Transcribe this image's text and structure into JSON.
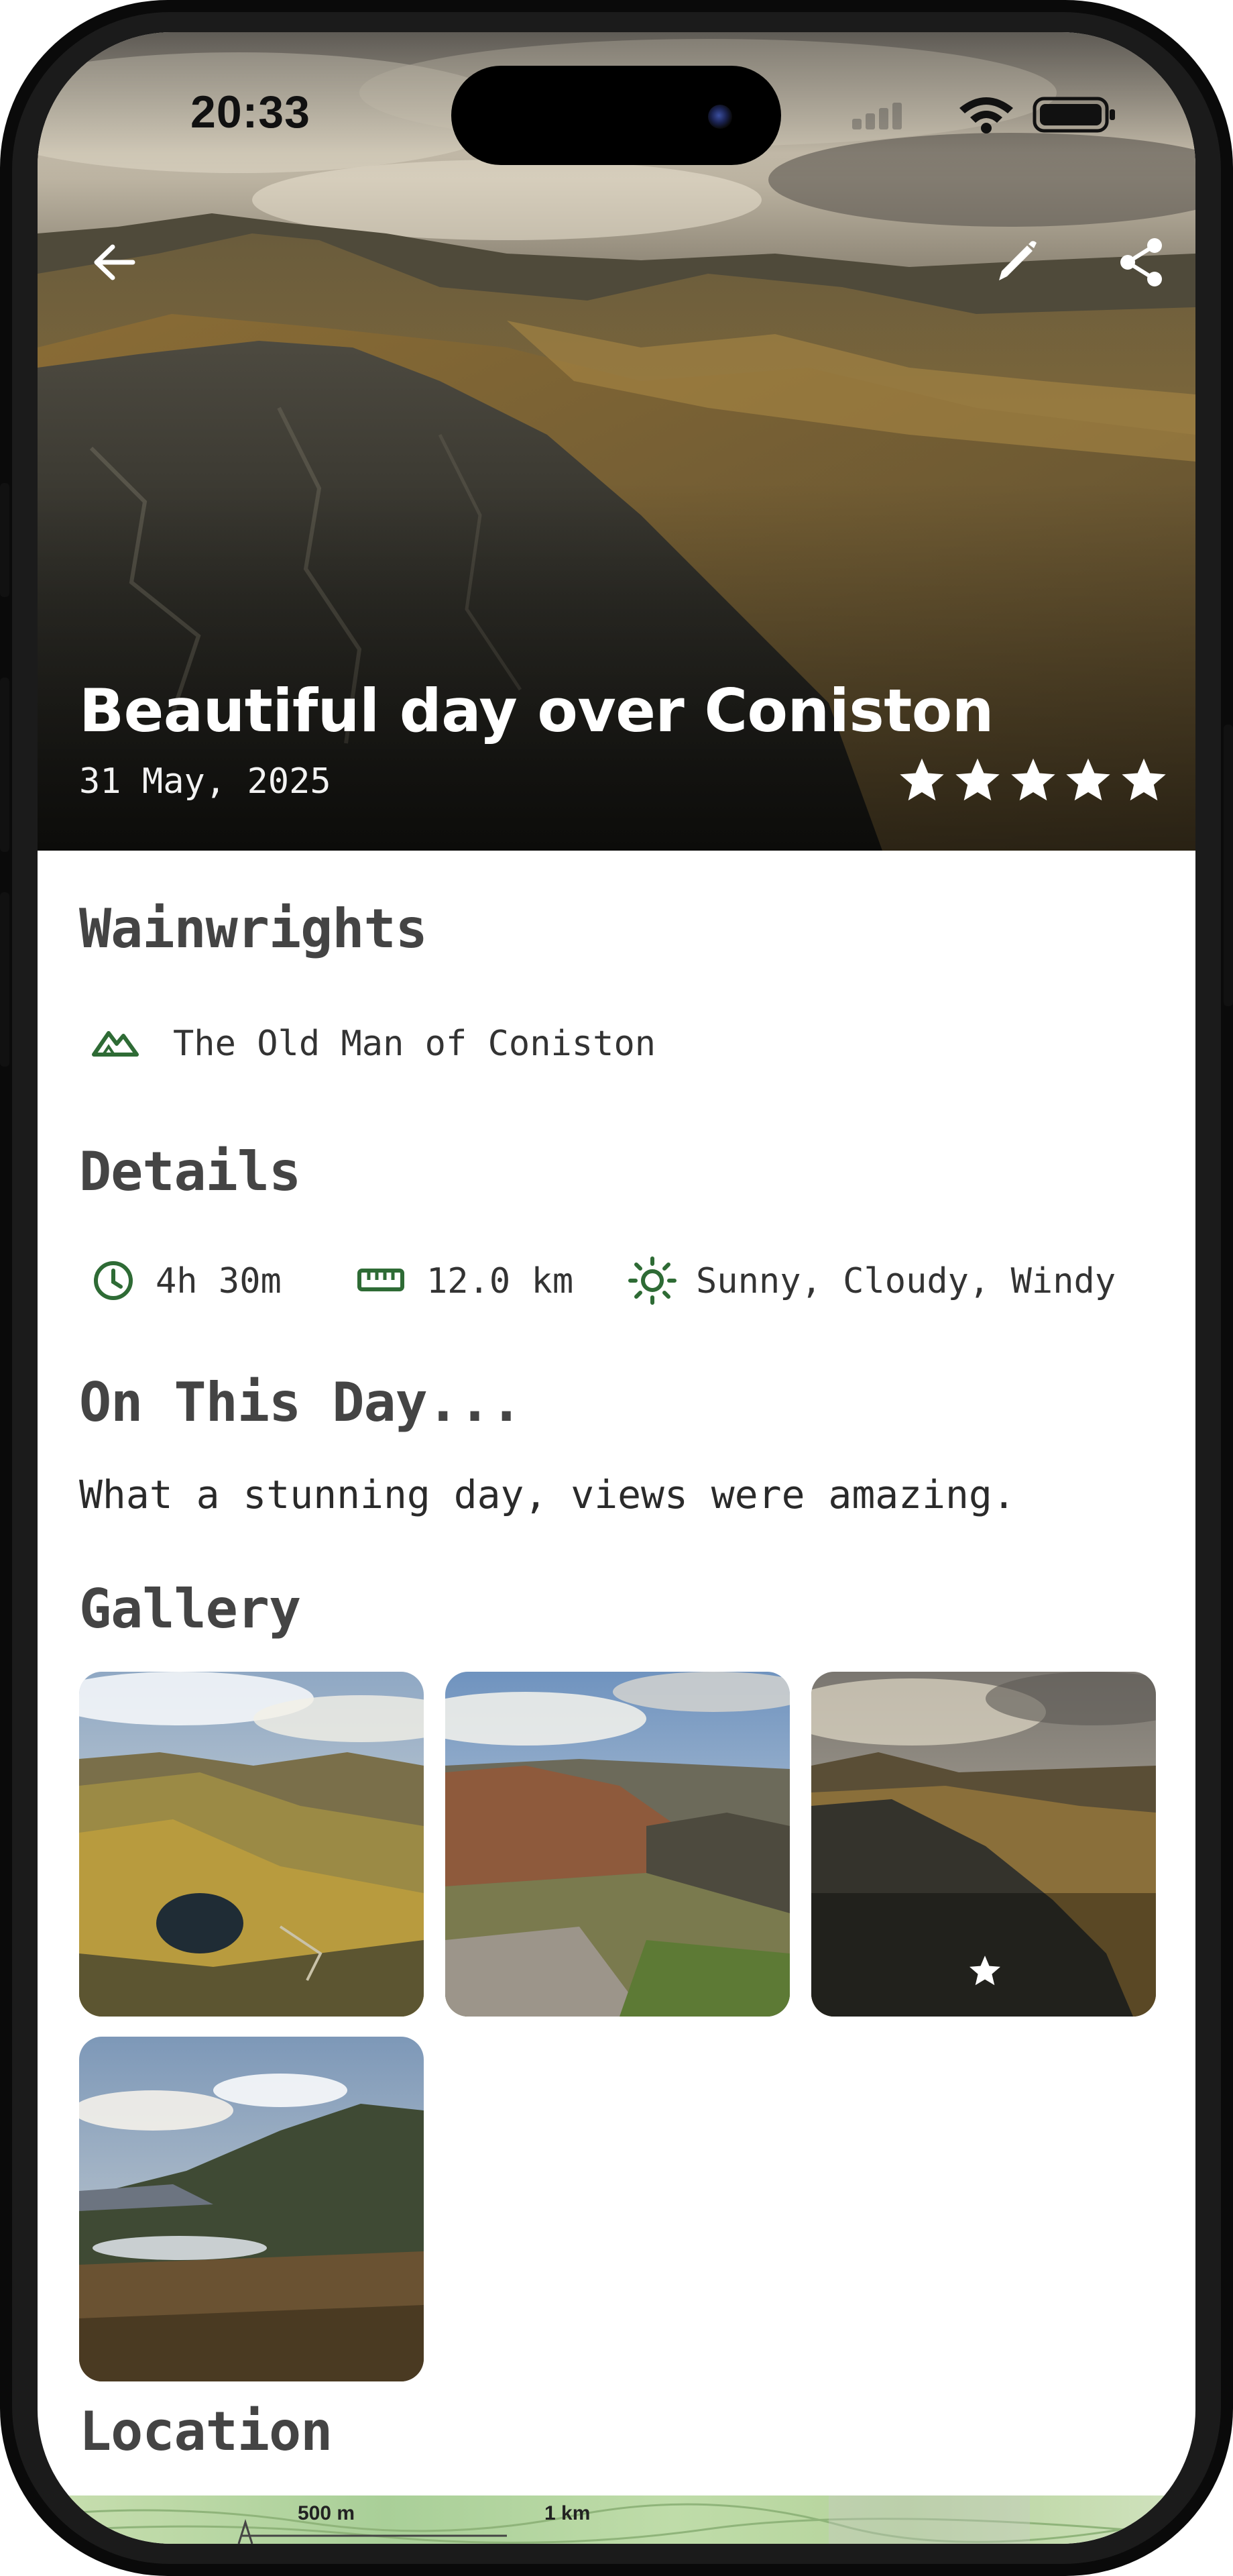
{
  "status_bar": {
    "time": "20:33"
  },
  "hero": {
    "title": "Beautiful day over Coniston",
    "date": "31 May, 2025",
    "rating": 5,
    "rating_max": 5
  },
  "wainwrights": {
    "heading": "Wainwrights",
    "items": [
      {
        "icon": "mountain-icon",
        "label": "The Old Man of Coniston"
      }
    ]
  },
  "details": {
    "heading": "Details",
    "duration": {
      "icon": "clock-icon",
      "value": "4h 30m"
    },
    "distance": {
      "icon": "ruler-icon",
      "value": "12.0 km"
    },
    "weather": {
      "icon": "sun-icon",
      "value": "Sunny, Cloudy, Windy"
    }
  },
  "on_this_day": {
    "heading": "On This Day...",
    "text": "What a stunning day, views were amazing."
  },
  "gallery": {
    "heading": "Gallery",
    "photos": [
      {
        "name": "photo-1",
        "favorite": false
      },
      {
        "name": "photo-2",
        "favorite": false
      },
      {
        "name": "photo-3",
        "favorite": true
      },
      {
        "name": "photo-4",
        "favorite": false
      }
    ]
  },
  "location": {
    "heading": "Location",
    "scale_labels": [
      "500 m",
      "1 km"
    ]
  },
  "colors": {
    "accent_green": "#2e6b35",
    "heading_grey": "#444444",
    "hero_text": "#ffffff"
  }
}
